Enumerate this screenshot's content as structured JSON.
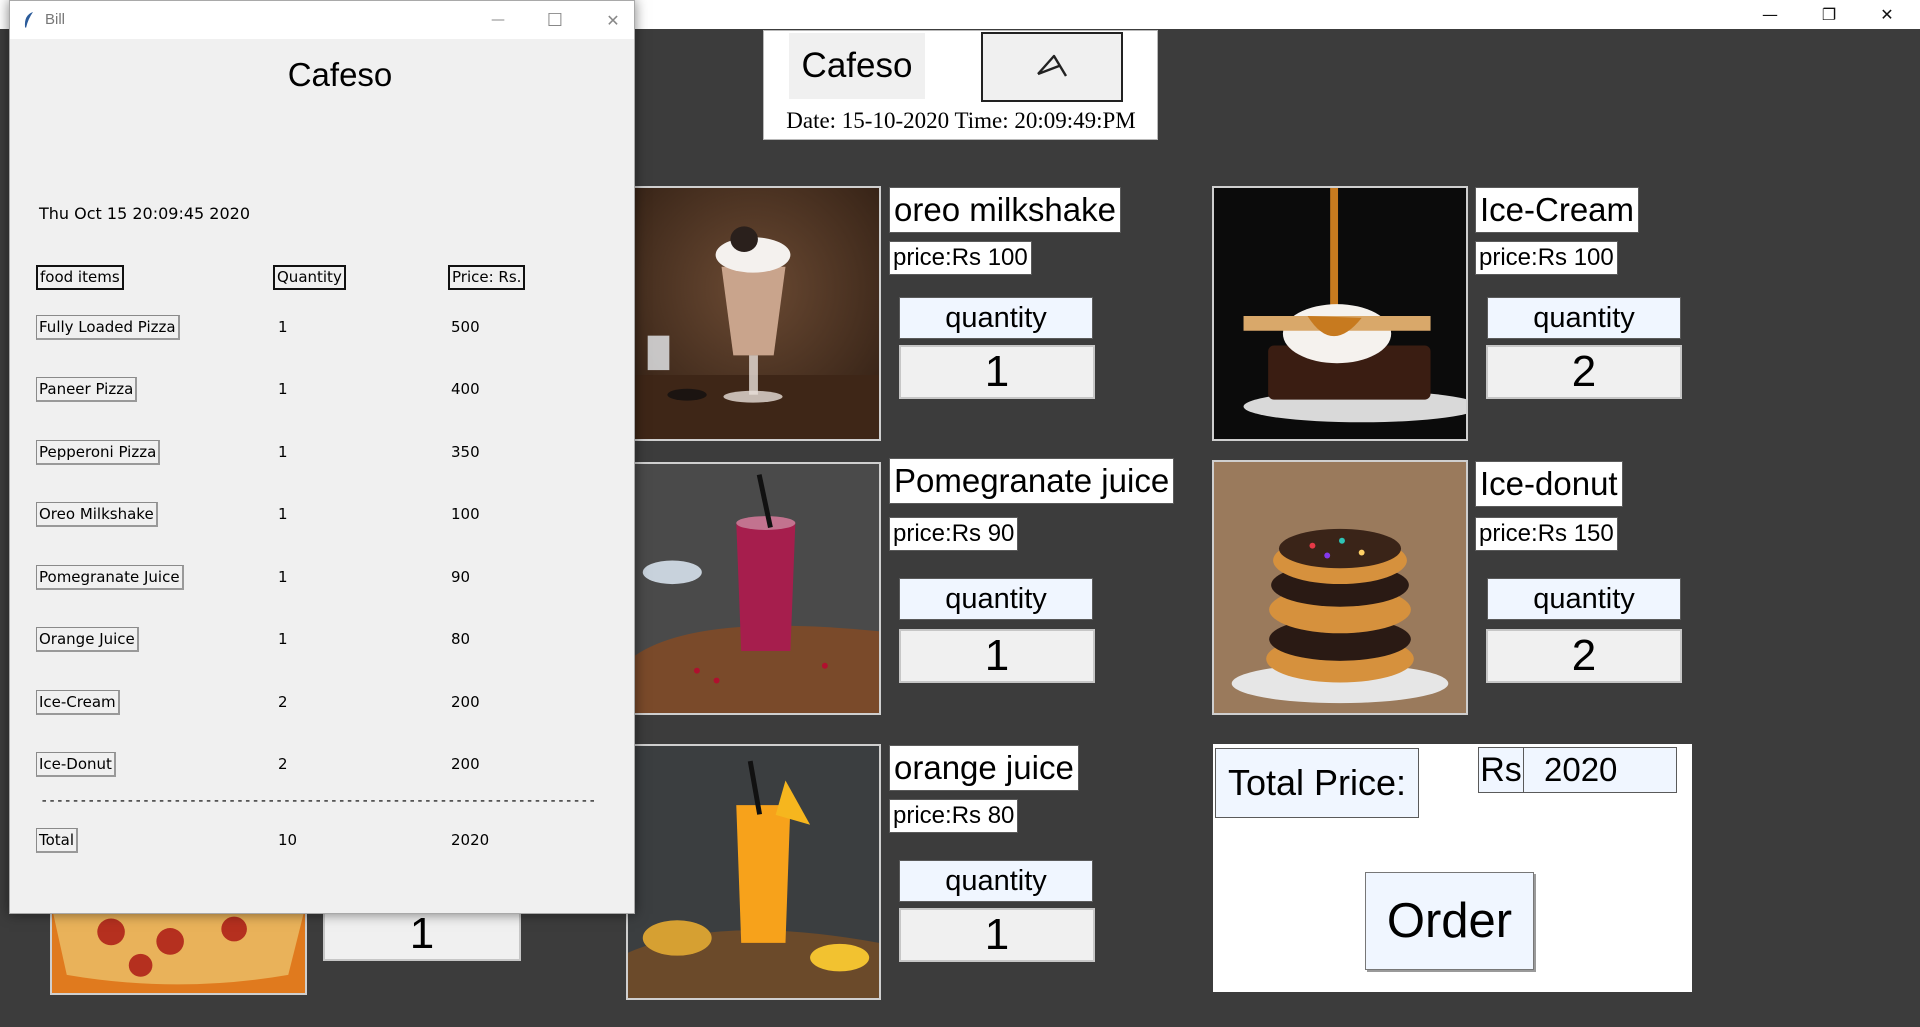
{
  "main_window": {
    "controls": {
      "minimize": "—",
      "restore": "❐",
      "close": "✕"
    }
  },
  "header": {
    "title": "Cafeso",
    "logo_icon": "arrow-logo-icon",
    "datetime": "Date: 15-10-2020 Time: 20:09:49:PM"
  },
  "products": [
    {
      "name": "oreo milkshake",
      "price": "price:Rs 100",
      "qty_label": "quantity",
      "qty": "1"
    },
    {
      "name": "Ice-Cream",
      "price": "price:Rs 100",
      "qty_label": "quantity",
      "qty": "2"
    },
    {
      "name": "Pomegranate juice",
      "price": "price:Rs 90",
      "qty_label": "quantity",
      "qty": "1"
    },
    {
      "name": "Ice-donut",
      "price": "price:Rs 150",
      "qty_label": "quantity",
      "qty": "2"
    },
    {
      "name": "orange juice",
      "price": "price:Rs 80",
      "qty_label": "quantity",
      "qty": "1"
    }
  ],
  "pizza": {
    "qty": "1"
  },
  "total": {
    "label": "Total Price:",
    "currency": "Rs",
    "value": "2020"
  },
  "order_label": "Order",
  "bill": {
    "window_title": "Bill",
    "controls": {
      "minimize": "—",
      "maximize": "☐",
      "close": "✕"
    },
    "cafe": "Cafeso",
    "datetime": "Thu Oct 15 20:09:45 2020",
    "headers": {
      "item": "food items",
      "quantity": "Quantity",
      "price": "Price: Rs."
    },
    "rows": [
      {
        "item": "Fully Loaded Pizza",
        "quantity": "1",
        "price": "500"
      },
      {
        "item": "Paneer Pizza",
        "quantity": "1",
        "price": "400"
      },
      {
        "item": "Pepperoni Pizza",
        "quantity": "1",
        "price": "350"
      },
      {
        "item": "Oreo Milkshake",
        "quantity": "1",
        "price": "100"
      },
      {
        "item": "Pomegranate Juice",
        "quantity": "1",
        "price": "90"
      },
      {
        "item": "Orange Juice",
        "quantity": "1",
        "price": "80"
      },
      {
        "item": "Ice-Cream",
        "quantity": "2",
        "price": "200"
      },
      {
        "item": "Ice-Donut",
        "quantity": "2",
        "price": "200"
      }
    ],
    "divider": "-----------------------------------------------------------------------",
    "total": {
      "label": "Total",
      "quantity": "10",
      "price": "2020"
    }
  }
}
